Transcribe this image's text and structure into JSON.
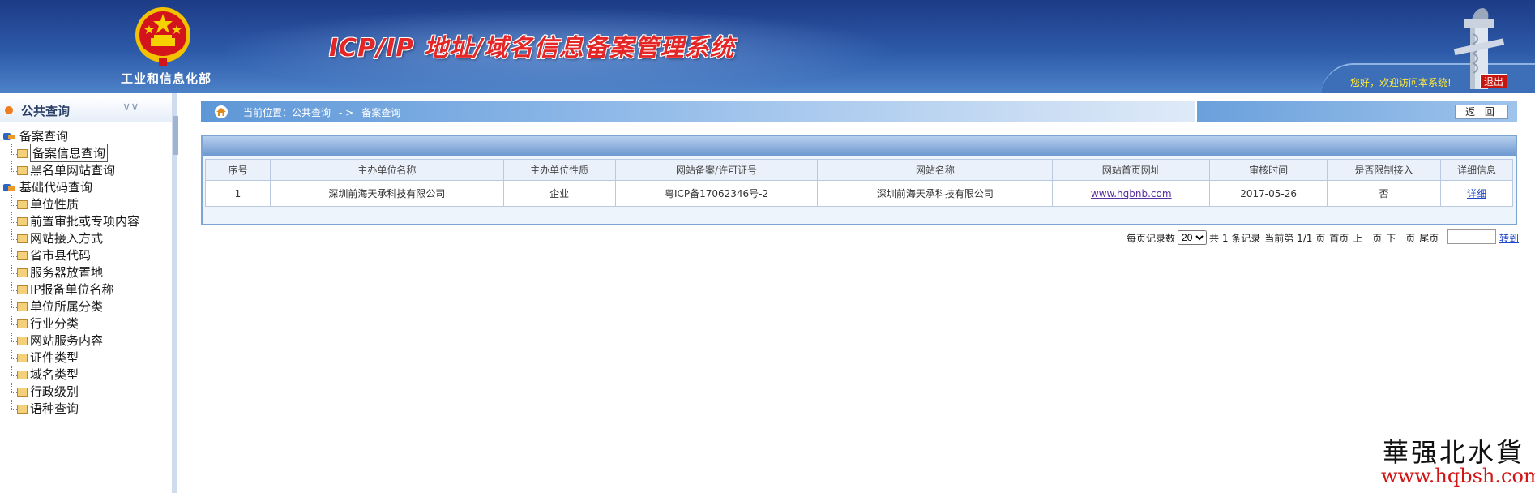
{
  "header": {
    "ministry": "工业和信息化部",
    "system_title": "ICP/IP 地址/域名信息备案管理系统",
    "welcome": "您好，欢迎访问本系统!",
    "logout": "退出"
  },
  "sidebar": {
    "title": "公共查询",
    "groups": [
      {
        "label": "备案查询",
        "items": [
          "备案信息查询",
          "黑名单网站查询"
        ]
      },
      {
        "label": "基础代码查询",
        "items": [
          "单位性质",
          "前置审批或专项内容",
          "网站接入方式",
          "省市县代码",
          "服务器放置地",
          "IP报备单位名称",
          "单位所属分类",
          "行业分类",
          "网站服务内容",
          "证件类型",
          "域名类型",
          "行政级别",
          "语种查询"
        ]
      }
    ]
  },
  "breadcrumb": {
    "label": "当前位置：",
    "path1": "公共查询",
    "sep": "- >",
    "path2": "备案查询"
  },
  "back_button": "返 回",
  "table": {
    "headers": [
      "序号",
      "主办单位名称",
      "主办单位性质",
      "网站备案/许可证号",
      "网站名称",
      "网站首页网址",
      "审核时间",
      "是否限制接入",
      "详细信息"
    ],
    "rows": [
      [
        "1",
        "深圳前海天承科技有限公司",
        "企业",
        "粤ICP备17062346号-2",
        "深圳前海天承科技有限公司",
        "www.hqbnb.com",
        "2017-05-26",
        "否",
        "详细"
      ]
    ]
  },
  "pager": {
    "per_page_label": "每页记录数",
    "per_page": "20",
    "total": "共 1 条记录",
    "current": "当前第 1/1 页",
    "first": "首页",
    "prev": "上一页",
    "next": "下一页",
    "last": "尾页",
    "goto": "转到"
  },
  "watermark": {
    "line1": "華强北水貨",
    "line2": "www.hqbsh.com"
  }
}
